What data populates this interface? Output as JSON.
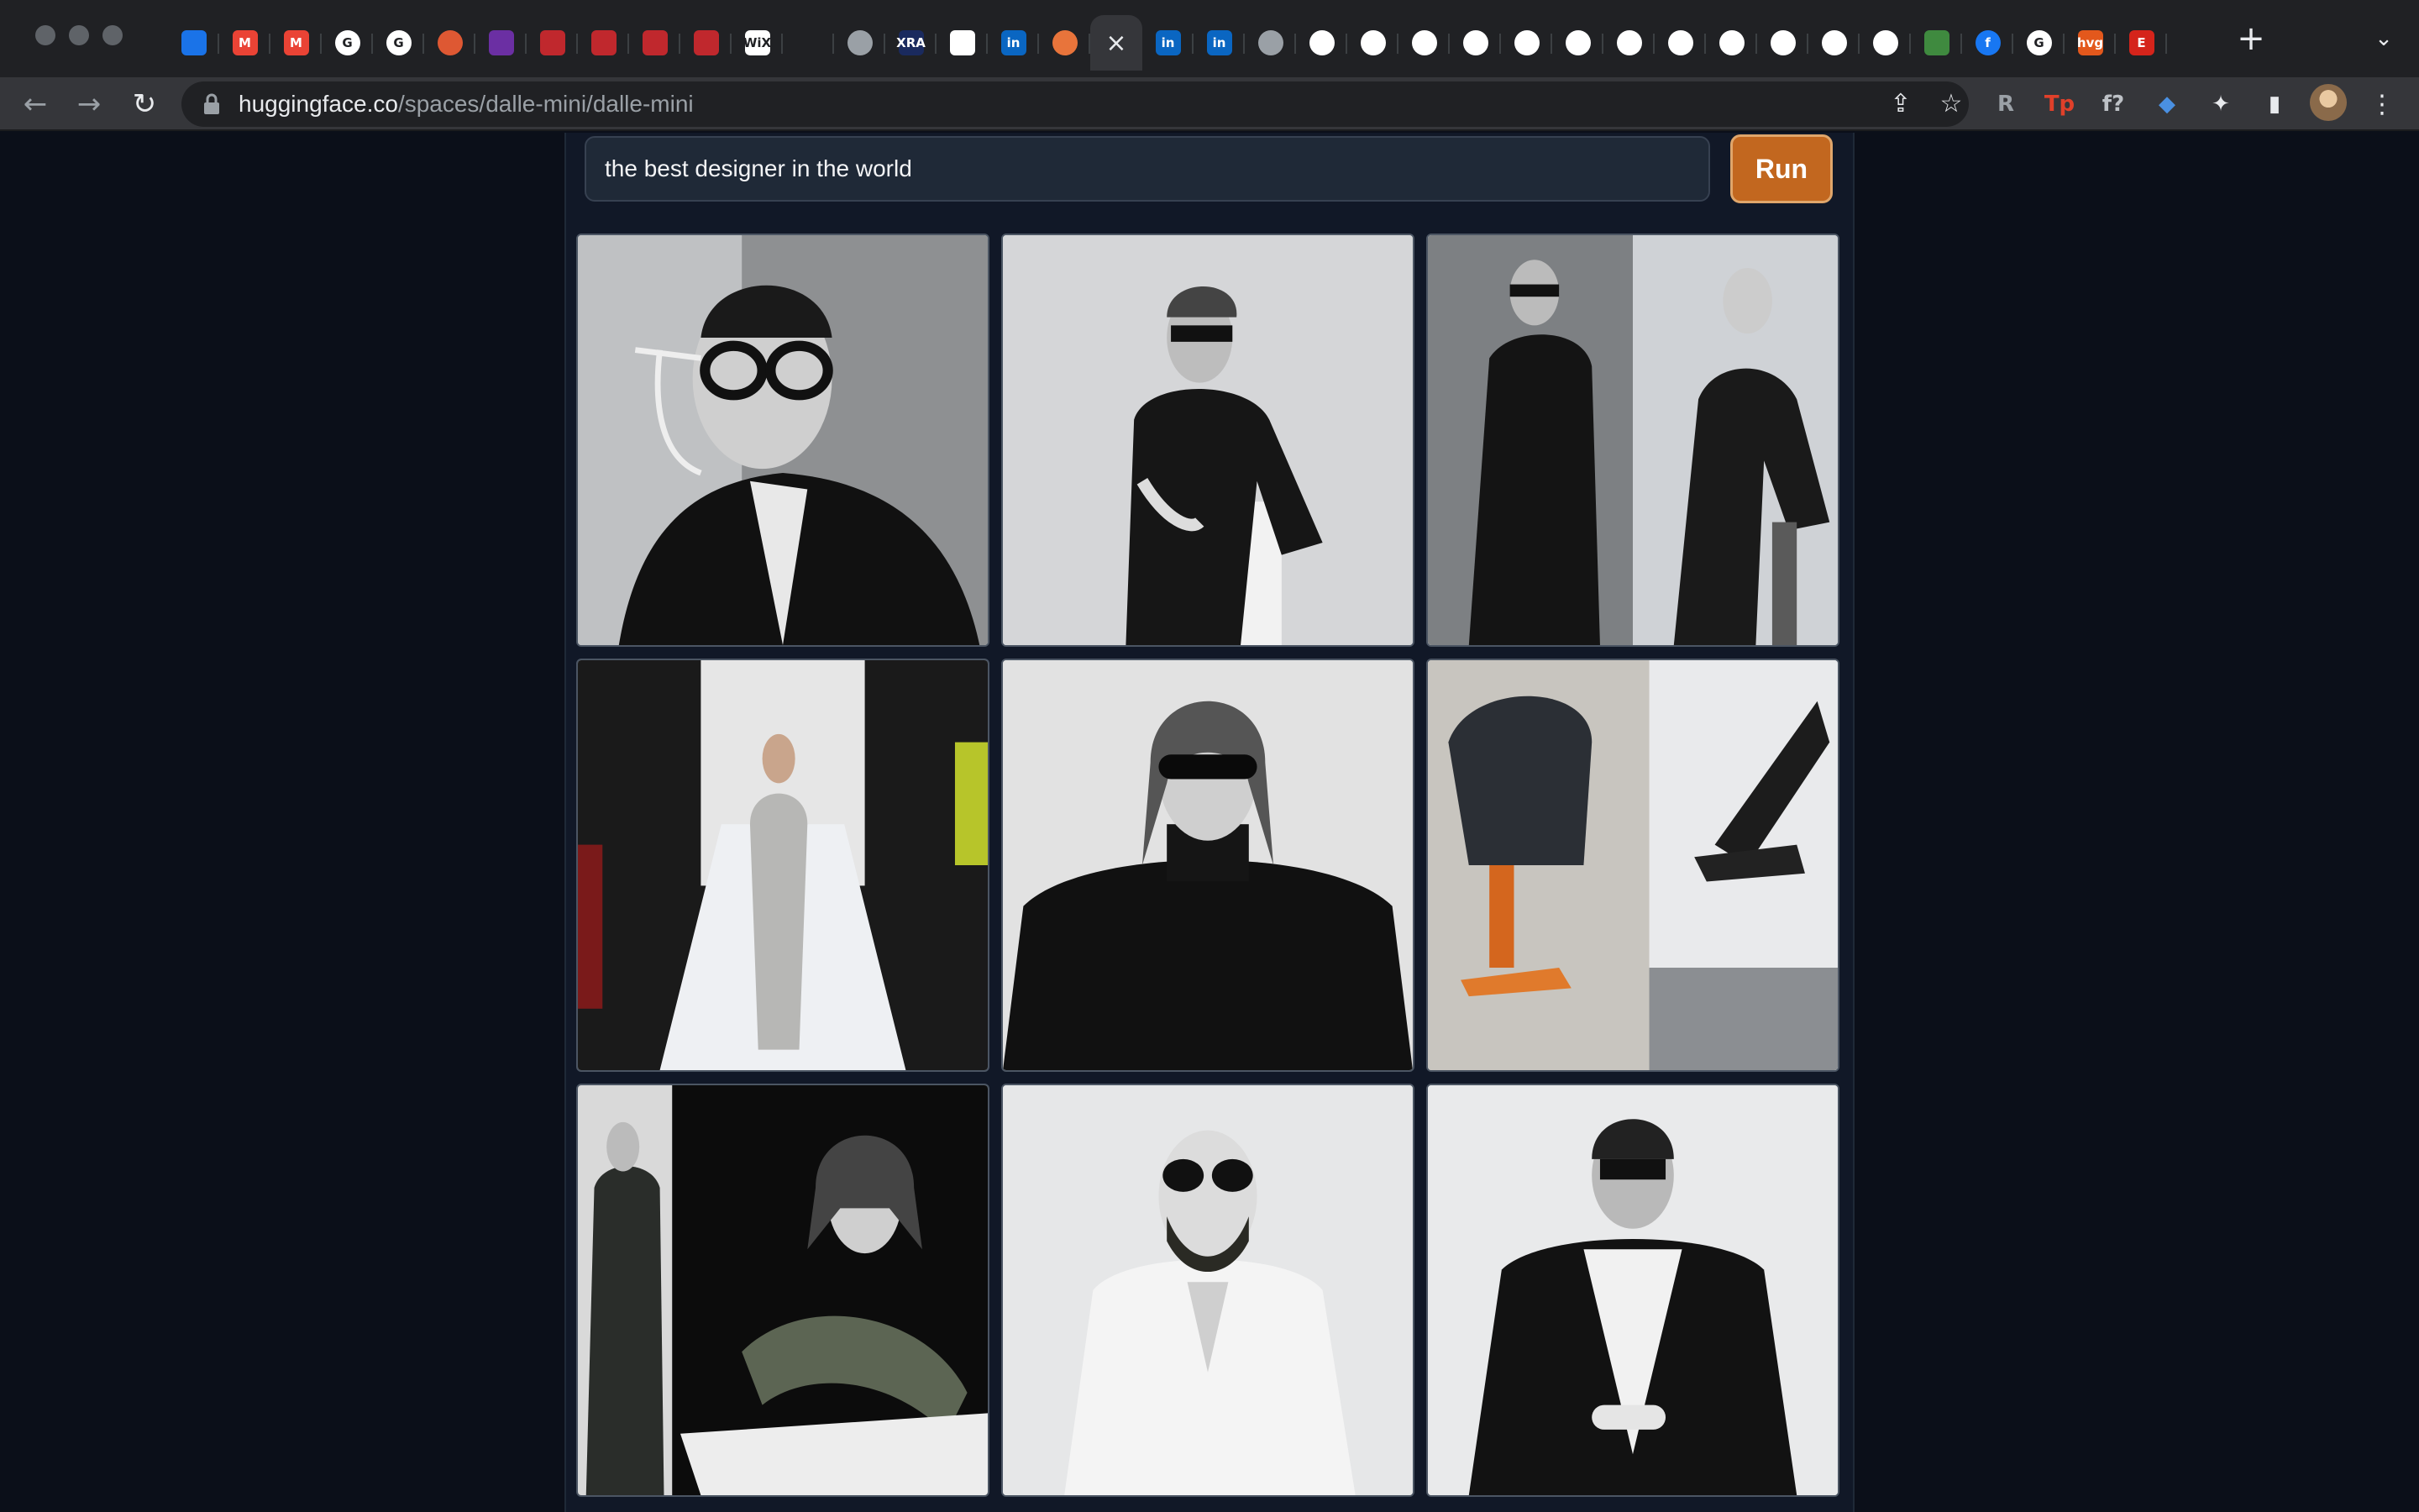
{
  "browser": {
    "url_host": "huggingface.co",
    "url_path": "/spaces/dalle-mini/dalle-mini",
    "tabs": [
      {
        "icon": "gem-icon",
        "label": "",
        "color": "#1a73e8"
      },
      {
        "icon": "gmail-icon",
        "label": "M",
        "color": "#ea4335"
      },
      {
        "icon": "gmail-icon",
        "label": "M",
        "color": "#ea4335"
      },
      {
        "icon": "google-icon",
        "label": "G",
        "color": "#ffffff"
      },
      {
        "icon": "google-icon",
        "label": "G",
        "color": "#ffffff"
      },
      {
        "icon": "duckduckgo-icon",
        "label": "",
        "color": "#de5833"
      },
      {
        "icon": "plant-icon",
        "label": "",
        "color": "#6b2fa3"
      },
      {
        "icon": "pin-icon",
        "label": "",
        "color": "#c0282d"
      },
      {
        "icon": "pin-icon",
        "label": "",
        "color": "#c0282d"
      },
      {
        "icon": "pin-icon",
        "label": "",
        "color": "#c0282d"
      },
      {
        "icon": "pin-icon",
        "label": "",
        "color": "#c0282d"
      },
      {
        "icon": "wix-icon",
        "label": "WiX",
        "color": "#ffffff"
      },
      {
        "icon": "blank-icon",
        "label": "",
        "color": "#202124"
      },
      {
        "icon": "globe-icon",
        "label": "",
        "color": "#9aa0a6"
      },
      {
        "icon": "xra-icon",
        "label": "XRA",
        "color": "#1a2a5e"
      },
      {
        "icon": "white-square-icon",
        "label": "",
        "color": "#ffffff"
      },
      {
        "icon": "linkedin-icon",
        "label": "in",
        "color": "#0a66c2"
      },
      {
        "icon": "huggingface-icon",
        "label": "",
        "color": "#e8743b"
      },
      {
        "icon": "close-icon",
        "label": "×",
        "color": "#35363a"
      },
      {
        "icon": "linkedin-icon",
        "label": "in",
        "color": "#0a66c2"
      },
      {
        "icon": "linkedin-icon",
        "label": "in",
        "color": "#0a66c2"
      },
      {
        "icon": "globe-icon",
        "label": "",
        "color": "#9aa0a6"
      },
      {
        "icon": "gear-icon",
        "label": "",
        "color": "#ffffff"
      },
      {
        "icon": "gear-icon",
        "label": "",
        "color": "#ffffff"
      },
      {
        "icon": "gear-icon",
        "label": "",
        "color": "#ffffff"
      },
      {
        "icon": "gear-icon",
        "label": "",
        "color": "#ffffff"
      },
      {
        "icon": "gear-icon",
        "label": "",
        "color": "#ffffff"
      },
      {
        "icon": "gear-icon",
        "label": "",
        "color": "#ffffff"
      },
      {
        "icon": "gear-icon",
        "label": "",
        "color": "#ffffff"
      },
      {
        "icon": "gear-icon",
        "label": "",
        "color": "#ffffff"
      },
      {
        "icon": "gear-icon",
        "label": "",
        "color": "#ffffff"
      },
      {
        "icon": "gear-icon",
        "label": "",
        "color": "#ffffff"
      },
      {
        "icon": "gear-icon",
        "label": "",
        "color": "#ffffff"
      },
      {
        "icon": "github-icon",
        "label": "",
        "color": "#ffffff"
      },
      {
        "icon": "battery-icon",
        "label": "",
        "color": "#3f8a3f"
      },
      {
        "icon": "facebook-icon",
        "label": "f",
        "color": "#1877f2"
      },
      {
        "icon": "google-icon",
        "label": "G",
        "color": "#ffffff"
      },
      {
        "icon": "hvg-icon",
        "label": "hvg",
        "color": "#e3581c"
      },
      {
        "icon": "etsy-icon",
        "label": "E",
        "color": "#d5241b"
      }
    ],
    "extensions": [
      {
        "icon": "readwise-icon",
        "label": "R",
        "color": "#9aa0a6"
      },
      {
        "icon": "tp-icon",
        "label": "Tp",
        "color": "#e0402a"
      },
      {
        "icon": "formula-icon",
        "label": "f?",
        "color": "#bdc1c6"
      },
      {
        "icon": "gem-icon",
        "label": "◆",
        "color": "#4a90e2"
      },
      {
        "icon": "puzzle-icon",
        "label": "✦",
        "color": "#e8eaed"
      },
      {
        "icon": "sidepanel-icon",
        "label": "▮",
        "color": "#e8eaed"
      }
    ]
  },
  "app": {
    "prompt_value": "the best designer in the world",
    "run_label": "Run",
    "accent_color": "#c2671f",
    "images": [
      {
        "name": "generated-image-1",
        "scene": "portrait-glasses"
      },
      {
        "name": "generated-image-2",
        "scene": "seated-figure"
      },
      {
        "name": "generated-image-3",
        "scene": "two-figures"
      },
      {
        "name": "generated-image-4",
        "scene": "runway"
      },
      {
        "name": "generated-image-5",
        "scene": "turtleneck-portrait"
      },
      {
        "name": "generated-image-6",
        "scene": "chairs"
      },
      {
        "name": "generated-image-7",
        "scene": "collage"
      },
      {
        "name": "generated-image-8",
        "scene": "white-suit"
      },
      {
        "name": "generated-image-9",
        "scene": "black-jacket"
      }
    ]
  }
}
